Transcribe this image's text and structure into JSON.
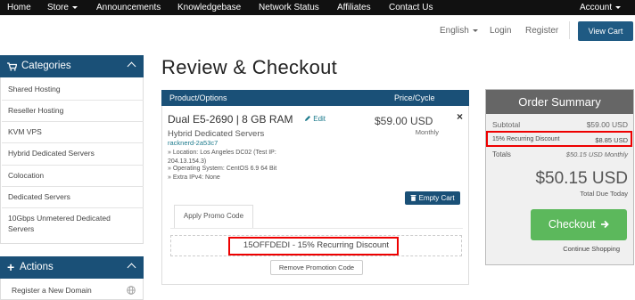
{
  "nav": {
    "home": "Home",
    "store": "Store",
    "announcements": "Announcements",
    "knowledgebase": "Knowledgebase",
    "network_status": "Network Status",
    "affiliates": "Affiliates",
    "contact_us": "Contact Us",
    "account": "Account"
  },
  "header": {
    "language": "English",
    "login": "Login",
    "register": "Register",
    "view_cart": "View Cart"
  },
  "sidebar": {
    "categories_title": "Categories",
    "categories": [
      "Shared Hosting",
      "Reseller Hosting",
      "KVM VPS",
      "Hybrid Dedicated Servers",
      "Colocation",
      "Dedicated Servers",
      "10Gbps Unmetered Dedicated Servers"
    ],
    "actions_title": "Actions",
    "actions": [
      "Register a New Domain"
    ]
  },
  "page": {
    "title": "Review & Checkout"
  },
  "cart": {
    "col_product": "Product/Options",
    "col_price": "Price/Cycle",
    "product_name": "Dual E5-2690 | 8 GB RAM",
    "edit": "Edit",
    "product_group": "Hybrid Dedicated Servers",
    "hostname": "racknerd-2a53c7",
    "opt_location": "» Location: Los Angeles DC02 (Test IP: 204.13.154.3)",
    "opt_os": "» Operating System: CentOS 6.9 64 Bit",
    "opt_ipv4": "» Extra IPv4: None",
    "price": "$59.00 USD",
    "cycle": "Monthly",
    "remove": "×",
    "empty_cart": "Empty Cart",
    "promo_tab": "Apply Promo Code",
    "promo_applied": "15OFFDEDI - 15% Recurring Discount",
    "remove_promo": "Remove Promotion Code"
  },
  "summary": {
    "title": "Order Summary",
    "subtotal_label": "Subtotal",
    "subtotal_value": "$59.00 USD",
    "discount_label": "15% Recurring Discount",
    "discount_value": "$8.85 USD",
    "totals_label": "Totals",
    "totals_value": "$50.15 USD Monthly",
    "total_due": "$50.15 USD",
    "total_due_label": "Total Due Today",
    "checkout": "Checkout",
    "continue_shopping": "Continue Shopping"
  },
  "colors": {
    "nav_bg": "#111111",
    "brand_blue": "#1a5077",
    "checkout_green": "#5cb85c",
    "highlight_red": "#ee0000",
    "link_teal": "#1b7a8c"
  }
}
